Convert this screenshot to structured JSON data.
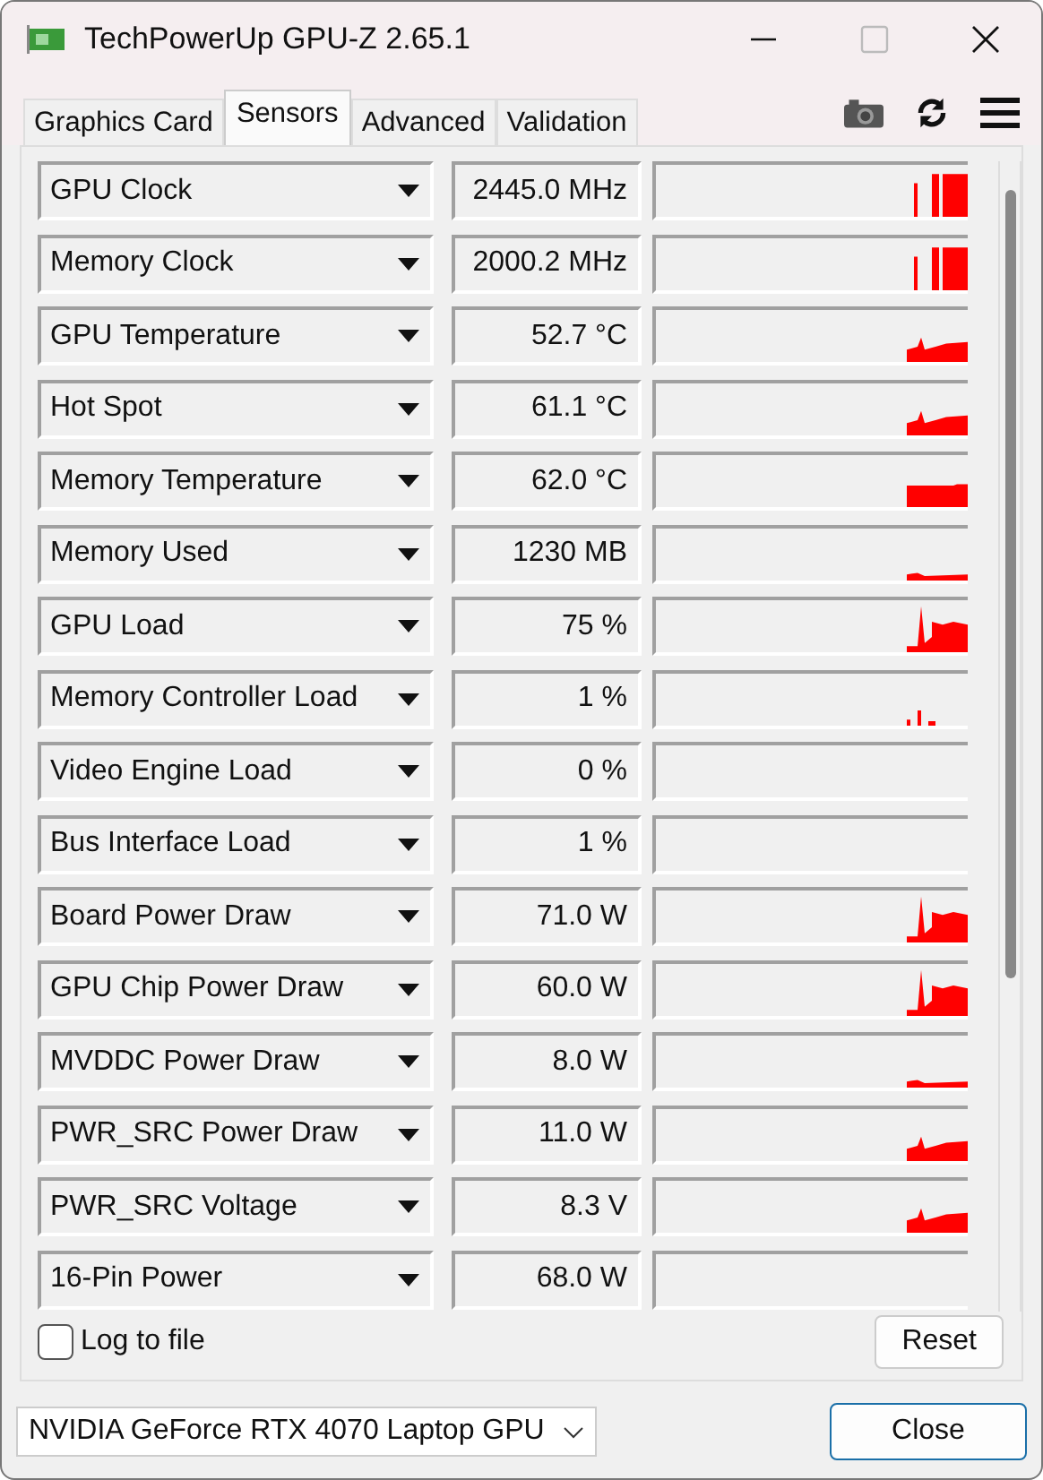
{
  "window": {
    "title": "TechPowerUp GPU-Z 2.65.1"
  },
  "tabs": [
    {
      "label": "Graphics Card",
      "selected": false
    },
    {
      "label": "Sensors",
      "selected": true
    },
    {
      "label": "Advanced",
      "selected": false
    },
    {
      "label": "Validation",
      "selected": false
    }
  ],
  "sensors": [
    {
      "name": "GPU Clock",
      "reading": "2445.0 MHz",
      "kind": "block"
    },
    {
      "name": "Memory Clock",
      "reading": "2000.2 MHz",
      "kind": "block"
    },
    {
      "name": "GPU Temperature",
      "reading": "52.7 °C",
      "kind": "low"
    },
    {
      "name": "Hot Spot",
      "reading": "61.1 °C",
      "kind": "low"
    },
    {
      "name": "Memory Temperature",
      "reading": "62.0 °C",
      "kind": "flat"
    },
    {
      "name": "Memory Used",
      "reading": "1230 MB",
      "kind": "tiny"
    },
    {
      "name": "GPU Load",
      "reading": "75 %",
      "kind": "spike"
    },
    {
      "name": "Memory Controller Load",
      "reading": "1 %",
      "kind": "dots"
    },
    {
      "name": "Video Engine Load",
      "reading": "0 %",
      "kind": "empty"
    },
    {
      "name": "Bus Interface Load",
      "reading": "1 %",
      "kind": "empty"
    },
    {
      "name": "Board Power Draw",
      "reading": "71.0 W",
      "kind": "spike"
    },
    {
      "name": "GPU Chip Power Draw",
      "reading": "60.0 W",
      "kind": "spike"
    },
    {
      "name": "MVDDC Power Draw",
      "reading": "8.0 W",
      "kind": "tiny"
    },
    {
      "name": "PWR_SRC Power Draw",
      "reading": "11.0 W",
      "kind": "low"
    },
    {
      "name": "PWR_SRC Voltage",
      "reading": "8.3 V",
      "kind": "low"
    },
    {
      "name": "16-Pin Power",
      "reading": "68.0 W",
      "kind": "empty"
    }
  ],
  "log_to_file": {
    "label": "Log to file",
    "checked": false
  },
  "reset_button": "Reset",
  "gpu_select": {
    "value": "NVIDIA GeForce RTX 4070 Laptop GPU"
  },
  "close_button": "Close"
}
